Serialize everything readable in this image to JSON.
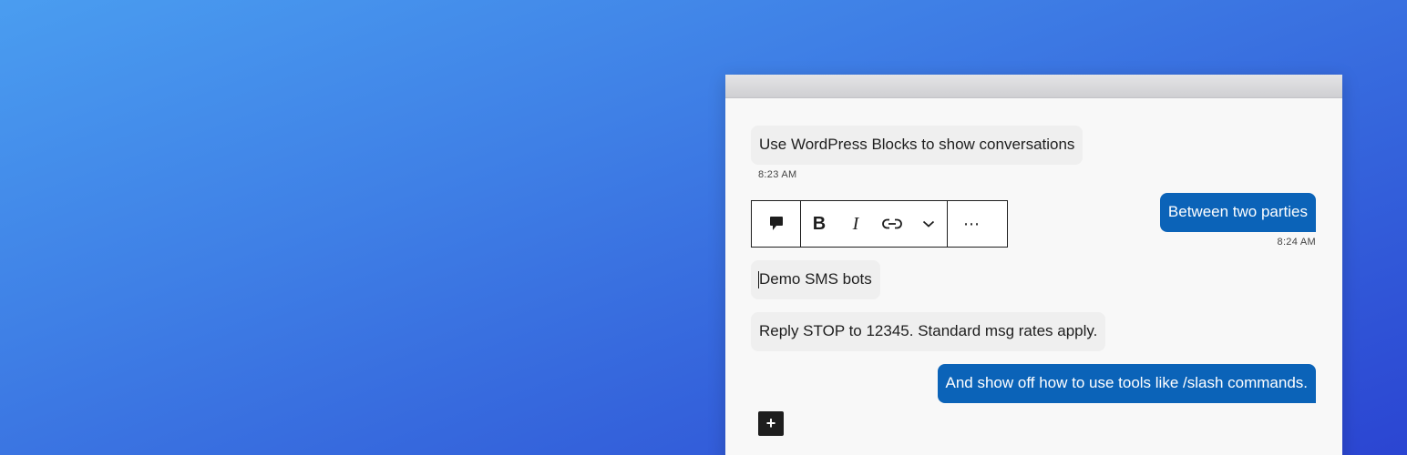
{
  "messages": [
    {
      "text": "Use WordPress Blocks to show conversations",
      "time": "8:23 AM",
      "side": "incoming"
    },
    {
      "text": "Between two parties",
      "time": "8:24 AM",
      "side": "outgoing"
    },
    {
      "text": "Demo SMS bots",
      "side": "incoming"
    },
    {
      "text": "Reply STOP to 12345. Standard msg rates apply.",
      "side": "incoming"
    },
    {
      "text": "And show off how to use tools like /slash commands.",
      "side": "outgoing"
    }
  ],
  "toolbar": {
    "block_icon": "speech-bubble-icon",
    "bold_label": "B",
    "italic_label": "I",
    "link_icon": "link-icon",
    "more_formats_icon": "chevron-down-icon",
    "options_label": "⋯"
  },
  "inserter": {
    "label": "+",
    "icon": "plus-icon"
  },
  "colors": {
    "outgoing_bubble": "#0b63b8",
    "incoming_bubble": "#efefef",
    "background_start": "#4a9df0",
    "background_end": "#2b45d2"
  }
}
